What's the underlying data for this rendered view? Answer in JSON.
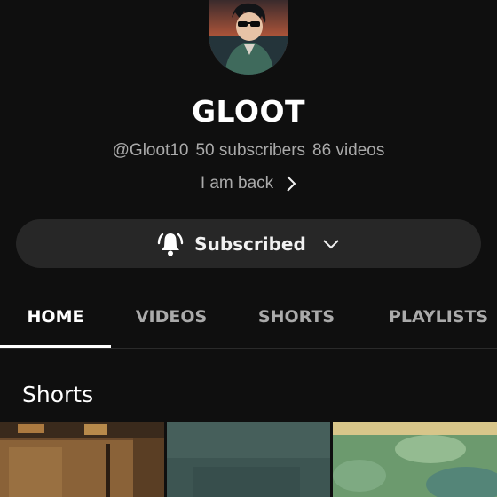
{
  "channel": {
    "name": "GLOOT",
    "handle": "@Gloot10",
    "subscribers": "50 subscribers",
    "videos": "86 videos",
    "description": "I am back"
  },
  "subscribe": {
    "label": "Subscribed"
  },
  "tabs": [
    {
      "label": "HOME",
      "active": true
    },
    {
      "label": "VIDEOS",
      "active": false
    },
    {
      "label": "SHORTS",
      "active": false
    },
    {
      "label": "PLAYLISTS",
      "active": false
    }
  ],
  "sections": {
    "shorts_title": "Shorts"
  },
  "icons": {
    "bell": "bell-ringing-icon",
    "dropdown": "chevron-down-icon",
    "more": "chevron-right-icon"
  },
  "colors": {
    "background": "#0f0f0f",
    "button": "#272727",
    "secondary_text": "#aaaaaa",
    "primary_text": "#ffffff"
  }
}
